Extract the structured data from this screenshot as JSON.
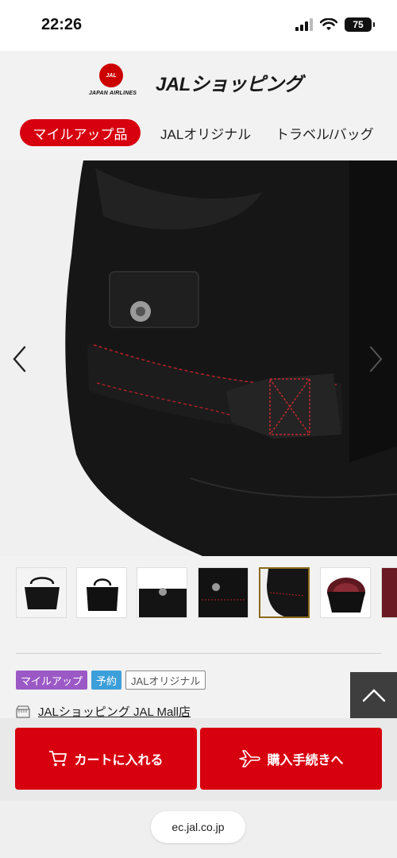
{
  "status_bar": {
    "time": "22:26",
    "battery": "75"
  },
  "header": {
    "logo_mark": "JAL",
    "airline_name": "JAPAN AIRLINES",
    "brand": "JALショッピング",
    "tabs": [
      {
        "label": "マイルアップ品",
        "active": true
      },
      {
        "label": "JALオリジナル",
        "active": false
      },
      {
        "label": "トラベル/バッグ",
        "active": false
      }
    ]
  },
  "gallery": {
    "thumbnail_count": 7,
    "selected_thumbnail": 5
  },
  "product": {
    "badges": [
      "マイルアップ",
      "予約",
      "JALオリジナル"
    ],
    "shop_name": "JALショッピング JAL Mall店"
  },
  "actions": {
    "cart_label": "カートに入れる",
    "buy_label": "購入手続きへ"
  },
  "browser": {
    "url": "ec.jal.co.jp"
  },
  "colors": {
    "accent": "#d7000f",
    "mileup_badge": "#9b59c6",
    "reserve_badge": "#3c9fd9"
  }
}
